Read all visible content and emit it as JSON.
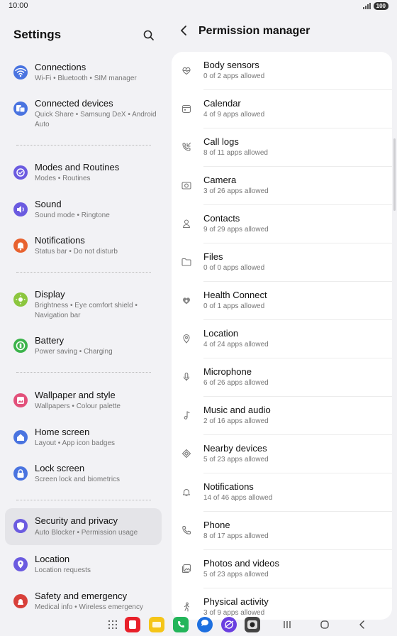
{
  "status": {
    "time": "10:00",
    "battery": "100"
  },
  "settings": {
    "title": "Settings",
    "items": [
      {
        "title": "Connections",
        "subtitle": "Wi-Fi  •  Bluetooth  •  SIM manager",
        "icon": "wifi-icon",
        "color": "#4a74e0"
      },
      {
        "title": "Connected devices",
        "subtitle": "Quick Share  •  Samsung DeX  •  Android Auto",
        "icon": "connected-devices-icon",
        "color": "#4a74e0"
      },
      {
        "title": "Modes and Routines",
        "subtitle": "Modes  •  Routines",
        "icon": "modes-icon",
        "color": "#6b5be0"
      },
      {
        "title": "Sound",
        "subtitle": "Sound mode  •  Ringtone",
        "icon": "sound-icon",
        "color": "#6b5be0"
      },
      {
        "title": "Notifications",
        "subtitle": "Status bar  •  Do not disturb",
        "icon": "bell-icon",
        "color": "#e8622f"
      },
      {
        "title": "Display",
        "subtitle": "Brightness  •  Eye comfort shield  •  Navigation bar",
        "icon": "display-icon",
        "color": "#8cc63e"
      },
      {
        "title": "Battery",
        "subtitle": "Power saving  •  Charging",
        "icon": "battery-icon",
        "color": "#3bb34a"
      },
      {
        "title": "Wallpaper and style",
        "subtitle": "Wallpapers  •  Colour palette",
        "icon": "wallpaper-icon",
        "color": "#e2507a"
      },
      {
        "title": "Home screen",
        "subtitle": "Layout  •  App icon badges",
        "icon": "home-icon",
        "color": "#4a74e0"
      },
      {
        "title": "Lock screen",
        "subtitle": "Screen lock and biometrics",
        "icon": "lock-icon",
        "color": "#4a74e0"
      },
      {
        "title": "Security and privacy",
        "subtitle": "Auto Blocker  •  Permission usage",
        "icon": "shield-icon",
        "color": "#6b5be0"
      },
      {
        "title": "Location",
        "subtitle": "Location requests",
        "icon": "location-icon",
        "color": "#6b5be0"
      },
      {
        "title": "Safety and emergency",
        "subtitle": "Medical info  •  Wireless emergency",
        "icon": "emergency-icon",
        "color": "#d8403a"
      }
    ]
  },
  "permissions": {
    "title": "Permission manager",
    "items": [
      {
        "title": "Body sensors",
        "subtitle": "0 of 2 apps allowed",
        "icon": "heart-monitor-icon"
      },
      {
        "title": "Calendar",
        "subtitle": "4 of 9 apps allowed",
        "icon": "calendar-icon"
      },
      {
        "title": "Call logs",
        "subtitle": "8 of 11 apps allowed",
        "icon": "call-log-icon"
      },
      {
        "title": "Camera",
        "subtitle": "3 of 26 apps allowed",
        "icon": "camera-icon"
      },
      {
        "title": "Contacts",
        "subtitle": "9 of 29 apps allowed",
        "icon": "contact-icon"
      },
      {
        "title": "Files",
        "subtitle": "0 of 0 apps allowed",
        "icon": "folder-icon"
      },
      {
        "title": "Health Connect",
        "subtitle": "0 of 1 apps allowed",
        "icon": "health-connect-icon"
      },
      {
        "title": "Location",
        "subtitle": "4 of 24 apps allowed",
        "icon": "location-pin-icon"
      },
      {
        "title": "Microphone",
        "subtitle": "6 of 26 apps allowed",
        "icon": "microphone-icon"
      },
      {
        "title": "Music and audio",
        "subtitle": "2 of 16 apps allowed",
        "icon": "music-note-icon"
      },
      {
        "title": "Nearby devices",
        "subtitle": "5 of 23 apps allowed",
        "icon": "nearby-devices-icon"
      },
      {
        "title": "Notifications",
        "subtitle": "14 of 46 apps allowed",
        "icon": "bell-icon"
      },
      {
        "title": "Phone",
        "subtitle": "8 of 17 apps allowed",
        "icon": "phone-icon"
      },
      {
        "title": "Photos and videos",
        "subtitle": "5 of 23 apps allowed",
        "icon": "photos-icon"
      },
      {
        "title": "Physical activity",
        "subtitle": "3 of 9 apps allowed",
        "icon": "activity-icon"
      }
    ]
  },
  "dock": [
    {
      "icon": "app-drawer-icon",
      "color": "#555555"
    },
    {
      "icon": "flipboard-app-icon",
      "color": "#e8202a"
    },
    {
      "icon": "notes-app-icon",
      "color": "#f5c518"
    },
    {
      "icon": "phone-app-icon",
      "color": "#23b55a"
    },
    {
      "icon": "messages-app-icon",
      "color": "#1d6fe0"
    },
    {
      "icon": "internet-app-icon",
      "color": "#6a3fe0"
    },
    {
      "icon": "camera-app-icon",
      "color": "#444444"
    }
  ]
}
